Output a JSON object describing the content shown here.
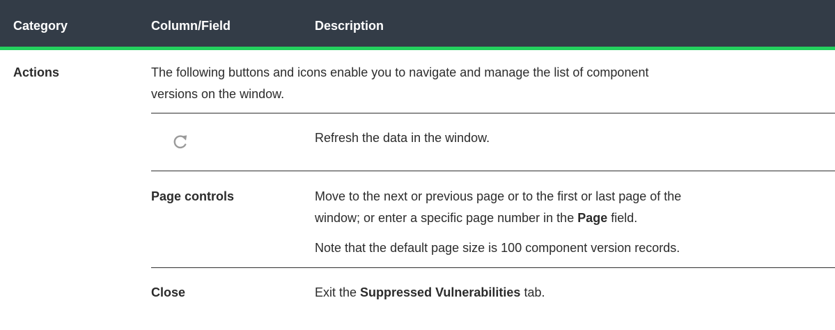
{
  "table": {
    "headers": {
      "category": "Category",
      "column_field": "Column/Field",
      "description": "Description"
    },
    "category": "Actions",
    "intro": {
      "line1": "The following buttons and icons enable you to navigate and manage the list of component",
      "line2": "versions on the window."
    },
    "rows": [
      {
        "icon": "refresh-icon",
        "description": "Refresh the data in the window."
      },
      {
        "field": "Page controls",
        "description_line1": "Move to the next or previous page or to the first or last page of the",
        "description_line2_before": "window; or enter a specific page number in the ",
        "description_line2_bold": "Page",
        "description_line2_after": " field.",
        "note": "Note that the default page size is 100 component version records."
      },
      {
        "field": "Close",
        "description_before": "Exit the ",
        "description_bold": "Suppressed Vulnerabilities",
        "description_after": " tab."
      }
    ],
    "colors": {
      "header_bg": "#333c47",
      "accent": "#24d15e",
      "icon": "#9a9a9a"
    }
  }
}
